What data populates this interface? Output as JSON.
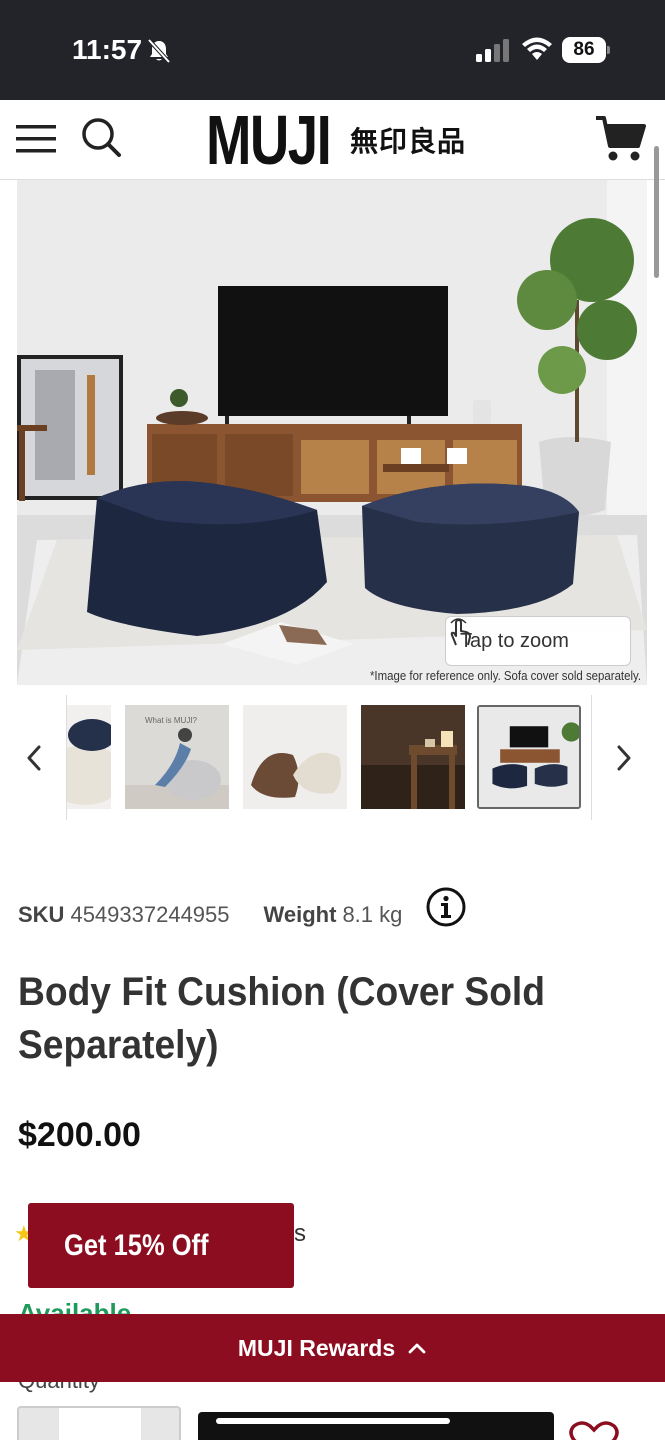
{
  "status_bar": {
    "time": "11:57",
    "battery": "86",
    "icons": [
      "bell-slash-icon",
      "signal-icon",
      "wifi-icon",
      "battery-icon"
    ]
  },
  "header": {
    "logo_main": "MUJI",
    "logo_sub": "無印良品",
    "icons": [
      "menu-icon",
      "search-icon",
      "cart-icon"
    ]
  },
  "gallery": {
    "zoom_label": "Tap to zoom",
    "image_note": "*Image for reference only. Sofa cover sold separately.",
    "thumbnails": [
      "thumb-cushion-white-navy",
      "thumb-person-on-cushion",
      "thumb-brown-white-cushions",
      "thumb-table-lamp",
      "thumb-living-room"
    ],
    "selected_index": 4
  },
  "product": {
    "sku_label": "SKU",
    "sku_value": "4549337244955",
    "weight_label": "Weight",
    "weight_value": "8.1 kg",
    "title": "Body Fit Cushion (Cover Sold Separately)",
    "price": "$200.00",
    "reviews_tail": "s",
    "availability": "Available"
  },
  "promo": {
    "label": "Get 15% Off"
  },
  "rewards_bar": {
    "label": "MUJI Rewards"
  },
  "purchase": {
    "quantity_label": "Quantity"
  },
  "colors": {
    "brand_red": "#8b0d1f",
    "status_bg": "#23232a",
    "available_green": "#1f9a5a"
  }
}
